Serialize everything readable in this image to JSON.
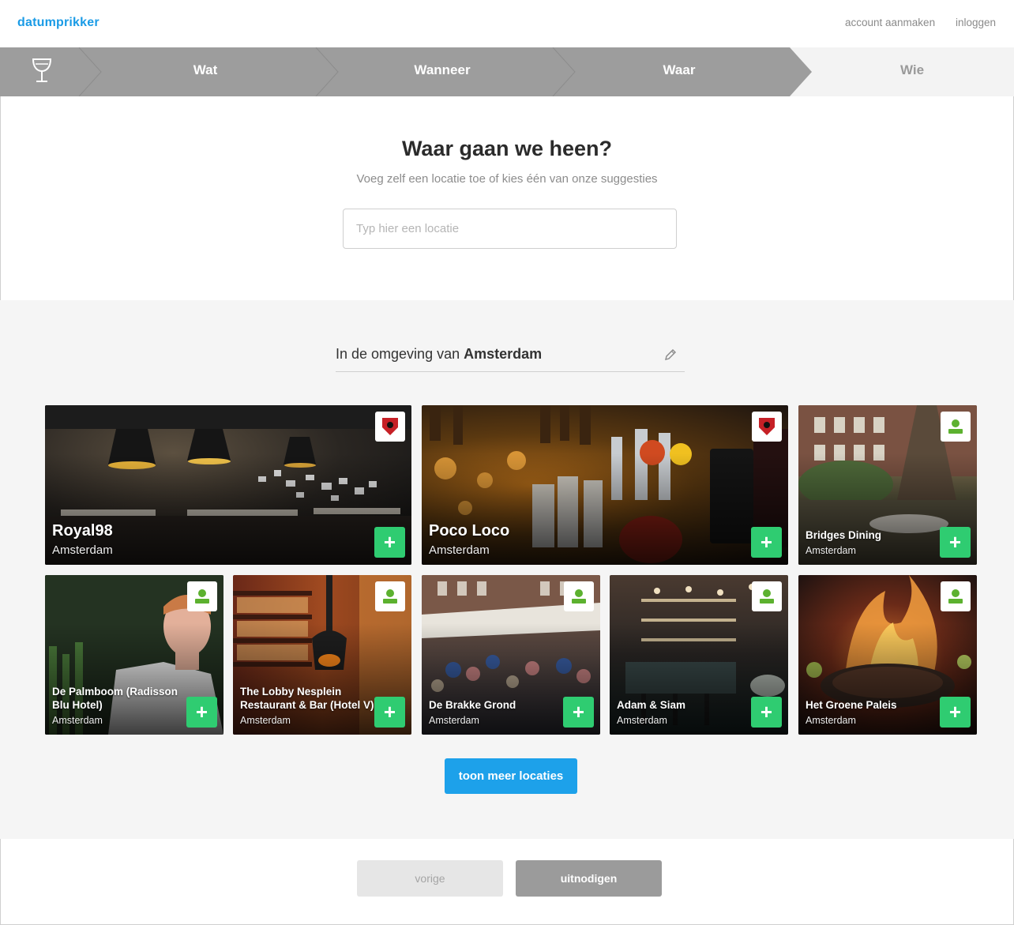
{
  "header": {
    "logo": "datumprikker",
    "create_account": "account aanmaken",
    "login": "inloggen"
  },
  "steps": [
    {
      "label": "",
      "state": "done",
      "icon": "cocktail-glass-icon"
    },
    {
      "label": "Wat",
      "state": "done"
    },
    {
      "label": "Wanneer",
      "state": "done"
    },
    {
      "label": "Waar",
      "state": "active"
    },
    {
      "label": "Wie",
      "state": "todo"
    }
  ],
  "main": {
    "title": "Waar gaan we heen?",
    "subtitle": "Voeg zelf een locatie toe of kies één van onze suggesties",
    "location_placeholder": "Typ hier een locatie"
  },
  "suggestions": {
    "near_prefix": "In de omgeving van",
    "near_city": "Amsterdam",
    "edit_icon": "pencil-icon",
    "cards": [
      {
        "name": "Royal98",
        "city": "Amsterdam",
        "partner": "jupiler",
        "theme": "dark"
      },
      {
        "name": "Poco Loco",
        "city": "Amsterdam",
        "partner": "jupiler",
        "theme": "bar"
      },
      {
        "name": "Bridges Dining",
        "city": "Amsterdam",
        "partner": "iens",
        "theme": "garden"
      },
      {
        "name": "De Palmboom (Radisson Blu Hotel)",
        "city": "Amsterdam",
        "partner": "iens",
        "theme": "chef"
      },
      {
        "name": "The Lobby Nesplein Restaurant & Bar (Hotel V)",
        "city": "Amsterdam",
        "partner": "iens",
        "theme": "library"
      },
      {
        "name": "De Brakke Grond",
        "city": "Amsterdam",
        "partner": "iens",
        "theme": "terrace"
      },
      {
        "name": "Adam & Siam",
        "city": "Amsterdam",
        "partner": "iens",
        "theme": "interior"
      },
      {
        "name": "Het Groene Paleis",
        "city": "Amsterdam",
        "partner": "iens",
        "theme": "fire"
      }
    ],
    "more_button": "toon meer locaties"
  },
  "footer": {
    "prev": "vorige",
    "invite": "uitnodigen"
  },
  "colors": {
    "brand": "#1a9be6",
    "add_green": "#2fcc71",
    "step_grey": "#9d9d9d"
  }
}
